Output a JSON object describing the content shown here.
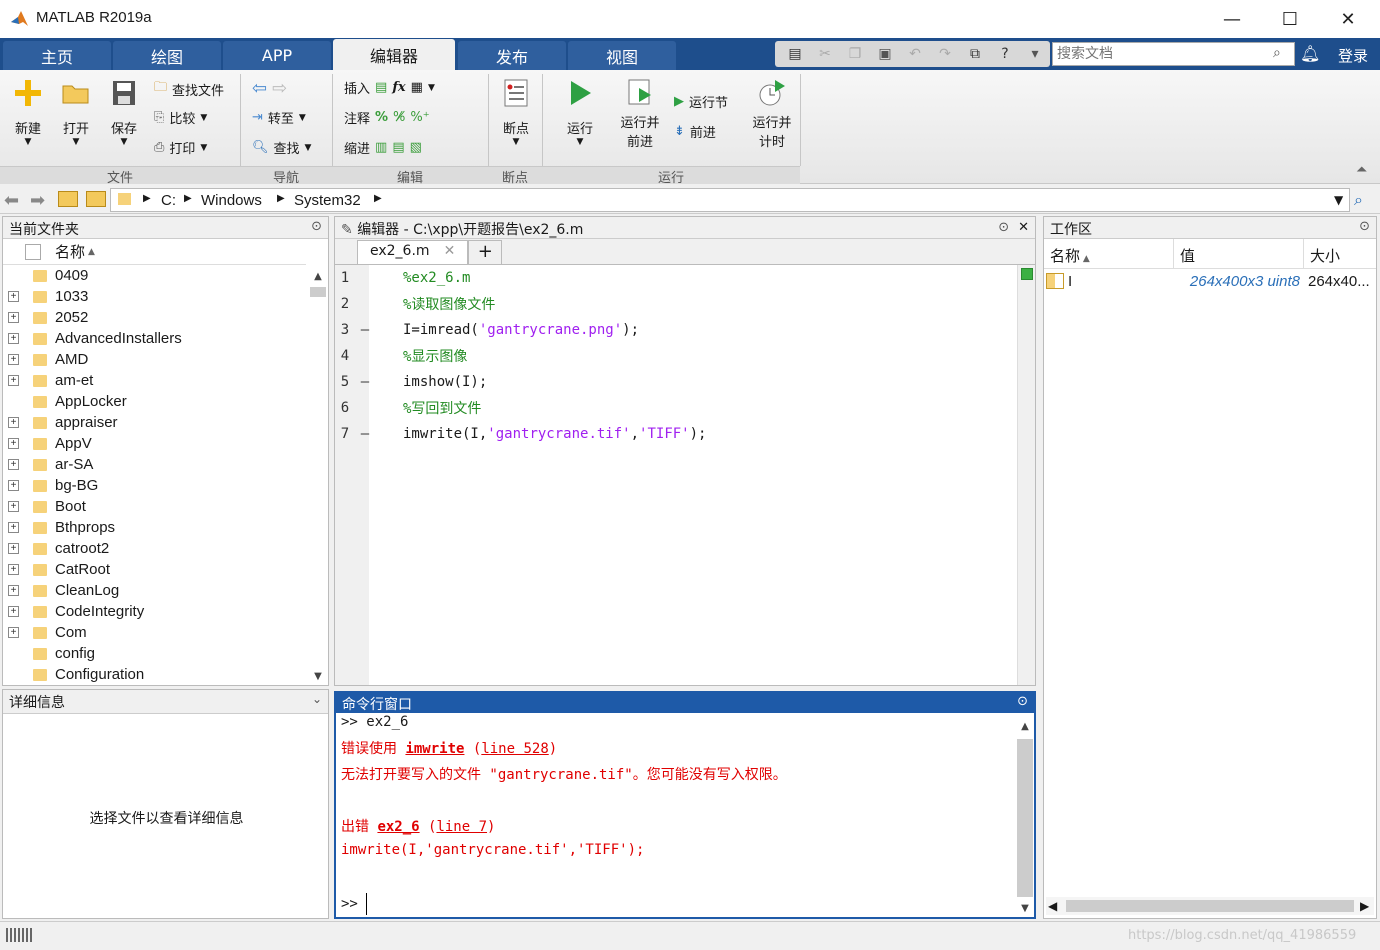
{
  "window": {
    "title": "MATLAB R2019a",
    "minimize_glyph": "—",
    "maximize_glyph": "☐",
    "close_glyph": "✕"
  },
  "tabs": [
    {
      "label": "主页"
    },
    {
      "label": "绘图"
    },
    {
      "label": "APP"
    },
    {
      "label": "编辑器"
    },
    {
      "label": "发布"
    },
    {
      "label": "视图"
    }
  ],
  "search": {
    "placeholder": "搜索文档",
    "login_label": "登录"
  },
  "ribbon": {
    "file": {
      "new": "新建",
      "open": "打开",
      "save": "保存",
      "find_file": "查找文件",
      "compare": "比较",
      "print": "打印",
      "group": "文件"
    },
    "nav": {
      "goto": "转至",
      "find": "查找",
      "group": "导航"
    },
    "edit": {
      "insert": "插入",
      "comment": "注释",
      "indent": "缩进",
      "group": "编辑"
    },
    "breakpoints": {
      "label": "断点",
      "group": "断点"
    },
    "run": {
      "run": "运行",
      "run_advance_1": "运行并",
      "run_advance_2": "前进",
      "run_section": "运行节",
      "advance": "前进",
      "run_time_1": "运行并",
      "run_time_2": "计时",
      "group": "运行"
    }
  },
  "address": {
    "drive": "C:",
    "folders": [
      "Windows",
      "System32"
    ]
  },
  "current_folder": {
    "title": "当前文件夹",
    "name_header": "名称",
    "items": [
      {
        "name": "0409",
        "expandable": false
      },
      {
        "name": "1033",
        "expandable": true
      },
      {
        "name": "2052",
        "expandable": true
      },
      {
        "name": "AdvancedInstallers",
        "expandable": true
      },
      {
        "name": "AMD",
        "expandable": true
      },
      {
        "name": "am-et",
        "expandable": true
      },
      {
        "name": "AppLocker",
        "expandable": false
      },
      {
        "name": "appraiser",
        "expandable": true
      },
      {
        "name": "AppV",
        "expandable": true
      },
      {
        "name": "ar-SA",
        "expandable": true
      },
      {
        "name": "bg-BG",
        "expandable": true
      },
      {
        "name": "Boot",
        "expandable": true
      },
      {
        "name": "Bthprops",
        "expandable": true
      },
      {
        "name": "catroot2",
        "expandable": true
      },
      {
        "name": "CatRoot",
        "expandable": true
      },
      {
        "name": "CleanLog",
        "expandable": true
      },
      {
        "name": "CodeIntegrity",
        "expandable": true
      },
      {
        "name": "Com",
        "expandable": true
      },
      {
        "name": "config",
        "expandable": false
      },
      {
        "name": "Configuration",
        "expandable": false
      }
    ]
  },
  "details": {
    "title": "详细信息",
    "placeholder": "选择文件以查看详细信息"
  },
  "editor": {
    "title": "编辑器 - C:\\xpp\\开题报告\\ex2_6.m",
    "tab_label": "ex2_6.m",
    "lines": [
      {
        "n": "1",
        "dash": "",
        "parts": [
          {
            "t": "%ex2_6.m",
            "c": "cmt"
          }
        ]
      },
      {
        "n": "2",
        "dash": "",
        "parts": [
          {
            "t": "%读取图像文件",
            "c": "cmt"
          }
        ]
      },
      {
        "n": "3",
        "dash": "—",
        "parts": [
          {
            "t": "I=imread(",
            "c": ""
          },
          {
            "t": "'gantrycrane.png'",
            "c": "str"
          },
          {
            "t": ");",
            "c": ""
          }
        ]
      },
      {
        "n": "4",
        "dash": "",
        "parts": [
          {
            "t": "%显示图像",
            "c": "cmt"
          }
        ]
      },
      {
        "n": "5",
        "dash": "—",
        "parts": [
          {
            "t": "imshow(I);",
            "c": ""
          }
        ]
      },
      {
        "n": "6",
        "dash": "",
        "parts": [
          {
            "t": "%写回到文件",
            "c": "cmt"
          }
        ]
      },
      {
        "n": "7",
        "dash": "—",
        "parts": [
          {
            "t": "imwrite(I,",
            "c": ""
          },
          {
            "t": "'gantrycrane.tif'",
            "c": "str"
          },
          {
            "t": ",",
            "c": ""
          },
          {
            "t": "'TIFF'",
            "c": "str"
          },
          {
            "t": ");",
            "c": ""
          }
        ]
      }
    ]
  },
  "command_window": {
    "title": "命令行窗口",
    "l1": ">> ex2_6",
    "l2a": "错误使用 ",
    "l2b": "imwrite",
    "l2c": " (",
    "l2d": "line 528",
    "l2e": ")",
    "l3": "无法打开要写入的文件 \"gantrycrane.tif\"。您可能没有写入权限。",
    "l4a": "出错 ",
    "l4b": "ex2_6",
    "l4c": " (",
    "l4d": "line 7",
    "l4e": ")",
    "l5": "imwrite(I,'gantrycrane.tif','TIFF');",
    "prompt": ">>"
  },
  "workspace": {
    "title": "工作区",
    "headers": {
      "name": "名称",
      "value": "值",
      "size": "大小"
    },
    "rows": [
      {
        "name": "I",
        "value": "264x400x3 uint8",
        "size": "264x40..."
      }
    ]
  },
  "watermark": "https://blog.csdn.net/qq_41986559"
}
